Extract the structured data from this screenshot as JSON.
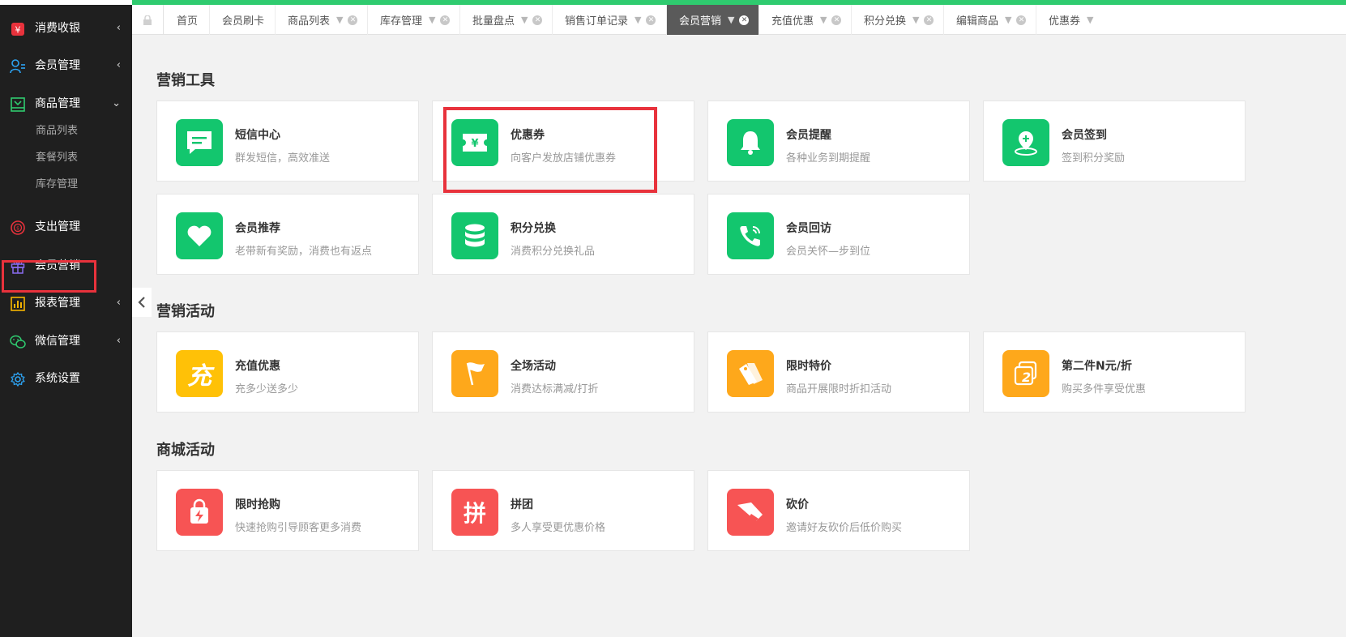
{
  "colors": {
    "accent_green": "#2fcb6f",
    "icon_green": "#13c66e",
    "icon_yellow": "#ffc107",
    "icon_orange": "#fea81b",
    "icon_red": "#f75454",
    "highlight_red": "#e8323c",
    "sidebar_bg": "#1f1f1f"
  },
  "sidebar": {
    "items": [
      {
        "label": "消费收银",
        "icon": "cashier-icon",
        "arrow": "‹"
      },
      {
        "label": "会员管理",
        "icon": "members-icon",
        "arrow": "‹"
      },
      {
        "label": "商品管理",
        "icon": "goods-icon",
        "arrow": "⌄"
      },
      {
        "label": "支出管理",
        "icon": "expense-icon",
        "arrow": ""
      },
      {
        "label": "会员营销",
        "icon": "gift-icon",
        "arrow": ""
      },
      {
        "label": "报表管理",
        "icon": "report-icon",
        "arrow": "‹"
      },
      {
        "label": "微信管理",
        "icon": "wechat-icon",
        "arrow": "‹"
      },
      {
        "label": "系统设置",
        "icon": "settings-icon",
        "arrow": ""
      }
    ],
    "sub_items": [
      "商品列表",
      "套餐列表",
      "库存管理"
    ],
    "active_item": "会员营销"
  },
  "tabs": [
    {
      "label": "首页"
    },
    {
      "label": "会员刷卡"
    },
    {
      "label": "商品列表"
    },
    {
      "label": "库存管理"
    },
    {
      "label": "批量盘点"
    },
    {
      "label": "销售订单记录"
    },
    {
      "label": "会员营销",
      "active": true
    },
    {
      "label": "充值优惠"
    },
    {
      "label": "积分兑换"
    },
    {
      "label": "编辑商品"
    },
    {
      "label": "优惠券"
    }
  ],
  "sections": {
    "tools": {
      "title": "营销工具",
      "cards": [
        {
          "title": "短信中心",
          "desc": "群发短信，高效准送",
          "icon": "sms-icon"
        },
        {
          "title": "优惠券",
          "desc": "向客户发放店铺优惠券",
          "icon": "coupon-icon"
        },
        {
          "title": "会员提醒",
          "desc": "各种业务到期提醒",
          "icon": "bell-icon"
        },
        {
          "title": "会员签到",
          "desc": "签到积分奖励",
          "icon": "checkin-icon"
        },
        {
          "title": "会员推荐",
          "desc": "老带新有奖励，消费也有返点",
          "icon": "heart-icon"
        },
        {
          "title": "积分兑换",
          "desc": "消费积分兑换礼品",
          "icon": "coins-icon"
        },
        {
          "title": "会员回访",
          "desc": "会员关怀—步到位",
          "icon": "phone-icon"
        }
      ]
    },
    "activities": {
      "title": "营销活动",
      "cards": [
        {
          "title": "充值优惠",
          "desc": "充多少送多少",
          "icon": "recharge-icon",
          "glyph": "充"
        },
        {
          "title": "全场活动",
          "desc": "消费达标满减/打折",
          "icon": "flag-icon"
        },
        {
          "title": "限时特价",
          "desc": "商品开展限时折扣活动",
          "icon": "price-tag-icon"
        },
        {
          "title": "第二件N元/折",
          "desc": "购买多件享受优惠",
          "icon": "second-item-icon",
          "glyph": "2"
        }
      ]
    },
    "mall": {
      "title": "商城活动",
      "cards": [
        {
          "title": "限时抢购",
          "desc": "快速抢购引导顾客更多消费",
          "icon": "flash-sale-icon"
        },
        {
          "title": "拼团",
          "desc": "多人享受更优惠价格",
          "icon": "group-buy-icon",
          "glyph": "拼"
        },
        {
          "title": "砍价",
          "desc": "邀请好友砍价后低价购买",
          "icon": "bargain-icon"
        }
      ]
    }
  }
}
